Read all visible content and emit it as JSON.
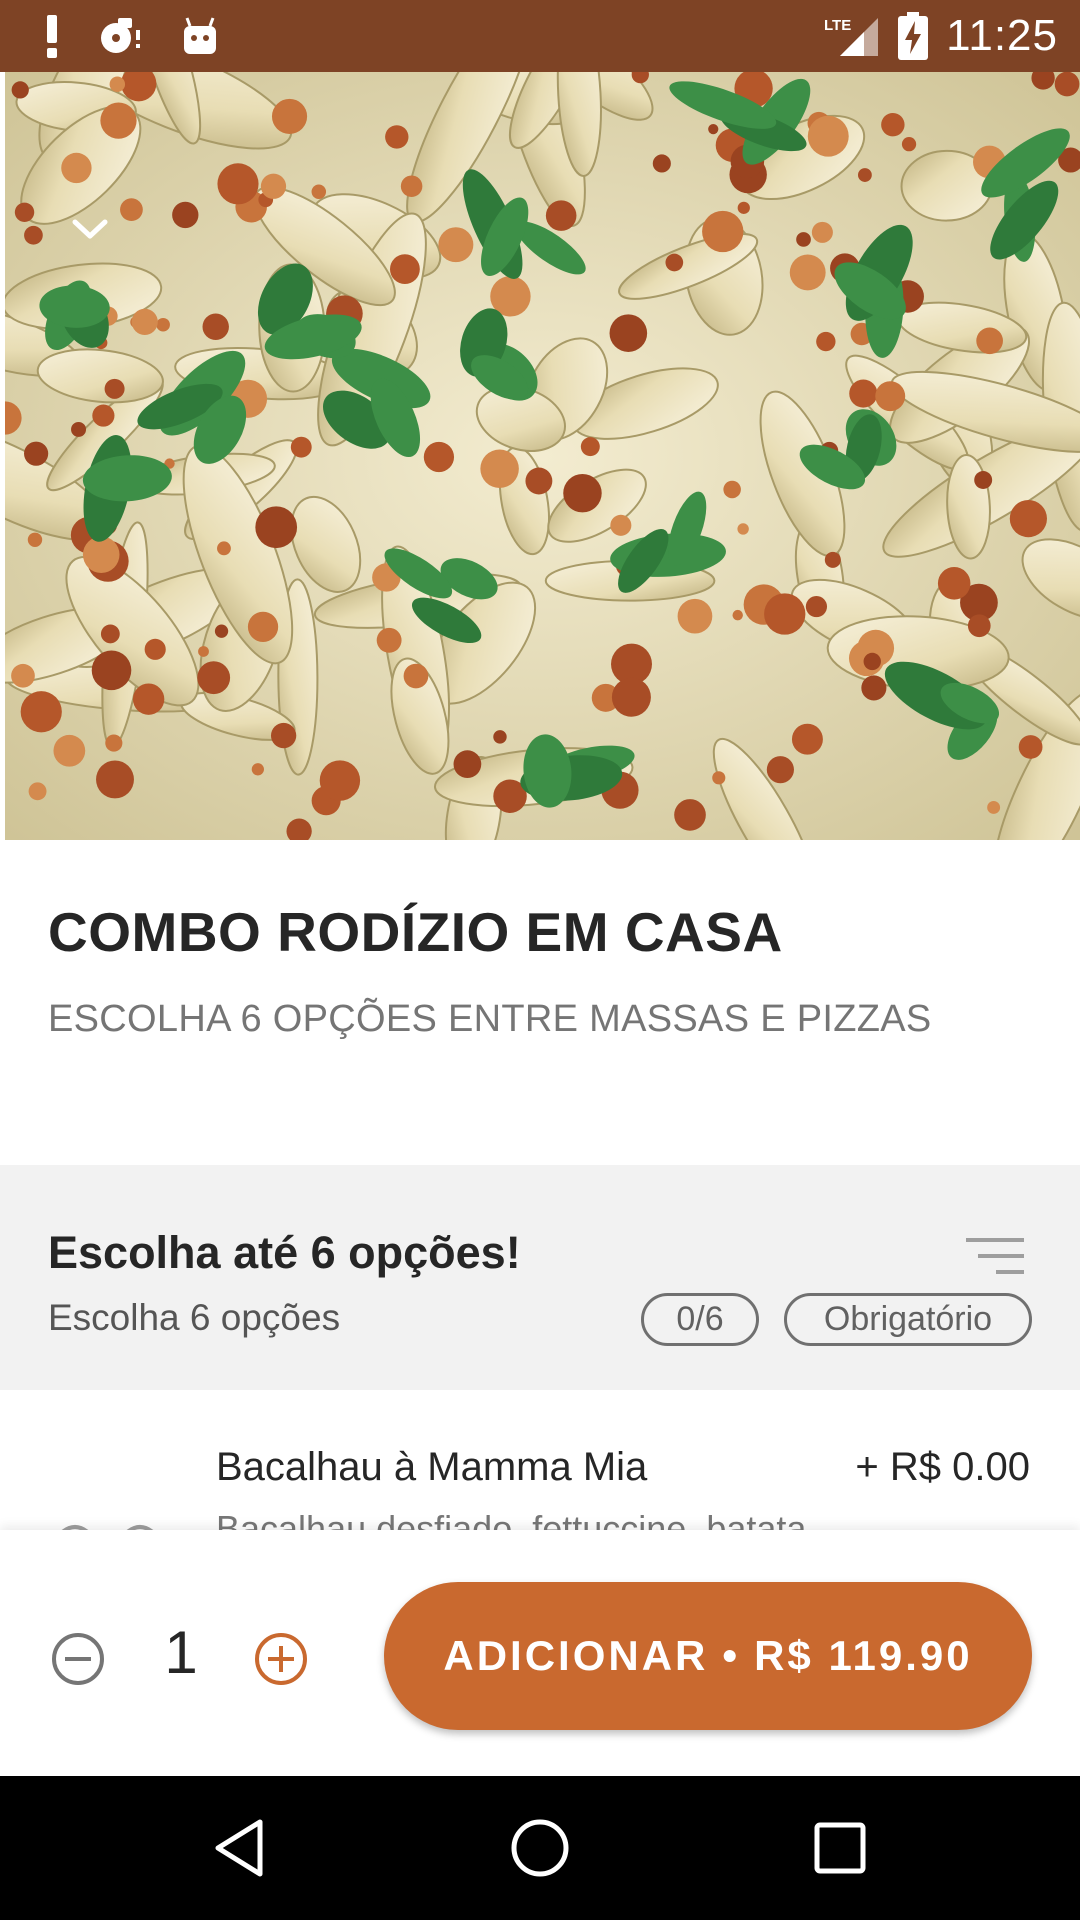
{
  "status_bar": {
    "time": "11:25",
    "network": "LTE",
    "icons": [
      "alert-icon",
      "media-icon",
      "android-icon",
      "signal-icon",
      "battery-charging-icon"
    ]
  },
  "hero": {
    "image_description_icon": "pasta-photo",
    "collapse_icon": "chevron-down-icon"
  },
  "product": {
    "title": "COMBO RODÍZIO EM CASA",
    "description": "ESCOLHA 6 OPÇÕES ENTRE MASSAS E PIZZAS"
  },
  "option_group": {
    "title": "Escolha até 6 opções!",
    "subtitle": "Escolha 6 opções",
    "count_badge": "0/6",
    "required_badge": "Obrigatório",
    "sort_icon": "filter-list-icon"
  },
  "options": [
    {
      "name": "Bacalhau à Mamma Mia",
      "price": "+ R$ 0.00",
      "description": "Bacalhau desfiado, fettuccine, batata"
    }
  ],
  "bottom_bar": {
    "quantity": "1",
    "add_label": "ADICIONAR",
    "separator": "•",
    "add_price": "R$ 119.90"
  },
  "colors": {
    "status_bar": "#7e4325",
    "accent": "#c9692f",
    "group_bg": "#f2f2f2",
    "nav_bar": "#000000"
  }
}
